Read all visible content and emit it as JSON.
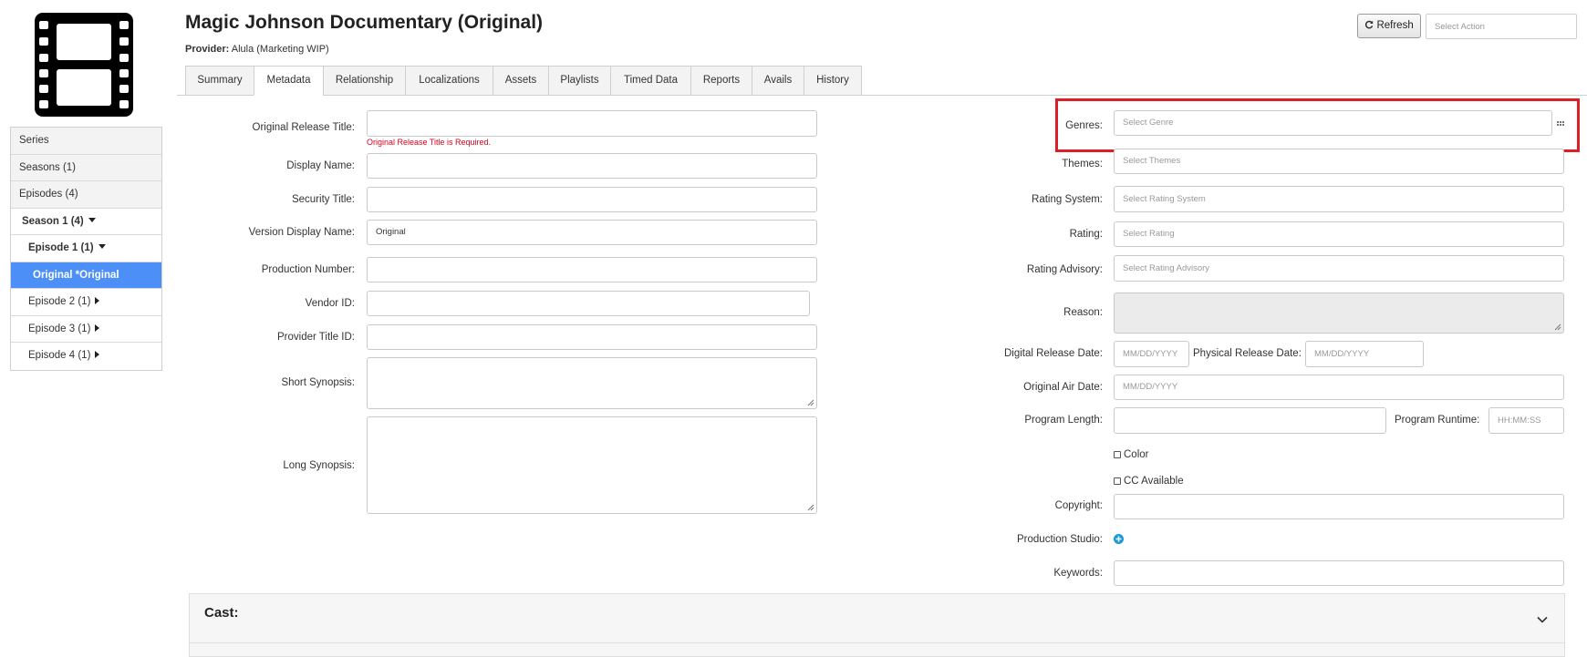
{
  "header": {
    "title": "Magic Johnson Documentary (Original)",
    "provider_label": "Provider:",
    "provider_value": "Alula (Marketing WIP)",
    "refresh_label": "Refresh",
    "action_placeholder": "Select Action"
  },
  "sidebar": {
    "items": [
      {
        "label": "Series"
      },
      {
        "label": "Seasons (1)"
      },
      {
        "label": "Episodes (4)"
      },
      {
        "label": "Season 1 (4)"
      },
      {
        "label": "Episode 1 (1)"
      },
      {
        "label": "Original *Original"
      },
      {
        "label": "Episode 2 (1)"
      },
      {
        "label": "Episode 3 (1)"
      },
      {
        "label": "Episode 4 (1)"
      }
    ]
  },
  "tabs": [
    {
      "label": "Summary"
    },
    {
      "label": "Metadata",
      "active": true
    },
    {
      "label": "Relationship"
    },
    {
      "label": "Localizations"
    },
    {
      "label": "Assets"
    },
    {
      "label": "Playlists"
    },
    {
      "label": "Timed Data"
    },
    {
      "label": "Reports"
    },
    {
      "label": "Avails"
    },
    {
      "label": "History"
    }
  ],
  "left_form": {
    "original_release_title": {
      "label": "Original Release Title:",
      "value": "",
      "error": "Original Release Title is Required."
    },
    "display_name": {
      "label": "Display Name:",
      "value": ""
    },
    "security_title": {
      "label": "Security Title:",
      "value": ""
    },
    "version_display_name": {
      "label": "Version Display Name:",
      "value": "Original"
    },
    "production_number": {
      "label": "Production Number:",
      "value": ""
    },
    "vendor_id": {
      "label": "Vendor ID:",
      "value": ""
    },
    "provider_title_id": {
      "label": "Provider Title ID:",
      "value": ""
    },
    "short_synopsis": {
      "label": "Short Synopsis:",
      "value": ""
    },
    "long_synopsis": {
      "label": "Long Synopsis:",
      "value": ""
    }
  },
  "right_form": {
    "genres": {
      "label": "Genres:",
      "placeholder": "Select Genre"
    },
    "themes": {
      "label": "Themes:",
      "placeholder": "Select Themes"
    },
    "rating_system": {
      "label": "Rating System:",
      "placeholder": "Select Rating System"
    },
    "rating": {
      "label": "Rating:",
      "placeholder": "Select Rating"
    },
    "rating_advisory": {
      "label": "Rating Advisory:",
      "placeholder": "Select Rating Advisory"
    },
    "reason": {
      "label": "Reason:",
      "value": ""
    },
    "digital_release_date": {
      "label": "Digital Release Date:",
      "placeholder": "MM/DD/YYYY"
    },
    "physical_release_date": {
      "label": "Physical Release Date:",
      "placeholder": "MM/DD/YYYY"
    },
    "original_air_date": {
      "label": "Original Air Date:",
      "placeholder": "MM/DD/YYYY"
    },
    "program_length": {
      "label": "Program Length:",
      "value": ""
    },
    "program_runtime": {
      "label": "Program Runtime:",
      "placeholder": "HH:MM:SS"
    },
    "color": {
      "label": "Color",
      "checked": false
    },
    "cc_available": {
      "label": "CC Available",
      "checked": false
    },
    "copyright": {
      "label": "Copyright:",
      "value": ""
    },
    "production_studio": {
      "label": "Production Studio:"
    },
    "keywords": {
      "label": "Keywords:",
      "value": ""
    }
  },
  "cast": {
    "title": "Cast:"
  },
  "colors": {
    "accent": "#4c8ff6",
    "error": "#d9001b",
    "highlight": "#dc1f26",
    "add_icon": "#1a9bd7"
  },
  "icons": [
    "film-icon",
    "refresh-icon",
    "caret-down-icon",
    "caret-right-icon",
    "drag-handle-icon",
    "add-circle-icon",
    "chevron-down-icon",
    "resize-grip-icon"
  ]
}
